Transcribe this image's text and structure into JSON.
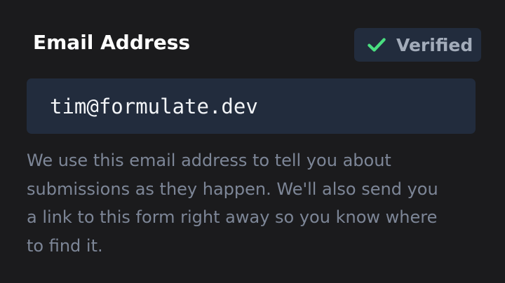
{
  "field": {
    "label": "Email Address",
    "value": "tim@formulate.dev"
  },
  "badge": {
    "icon": "check-icon",
    "text": "Verified",
    "icon_color": "#4ade80"
  },
  "help_text": [
    "We use this email address to tell you about",
    "submissions as they happen. We'll also send you",
    "a link to this form right away so you know where",
    "to find it."
  ],
  "colors": {
    "background": "#1b1b1d",
    "field_background": "#222c3d",
    "help_text": "#7d8697"
  }
}
